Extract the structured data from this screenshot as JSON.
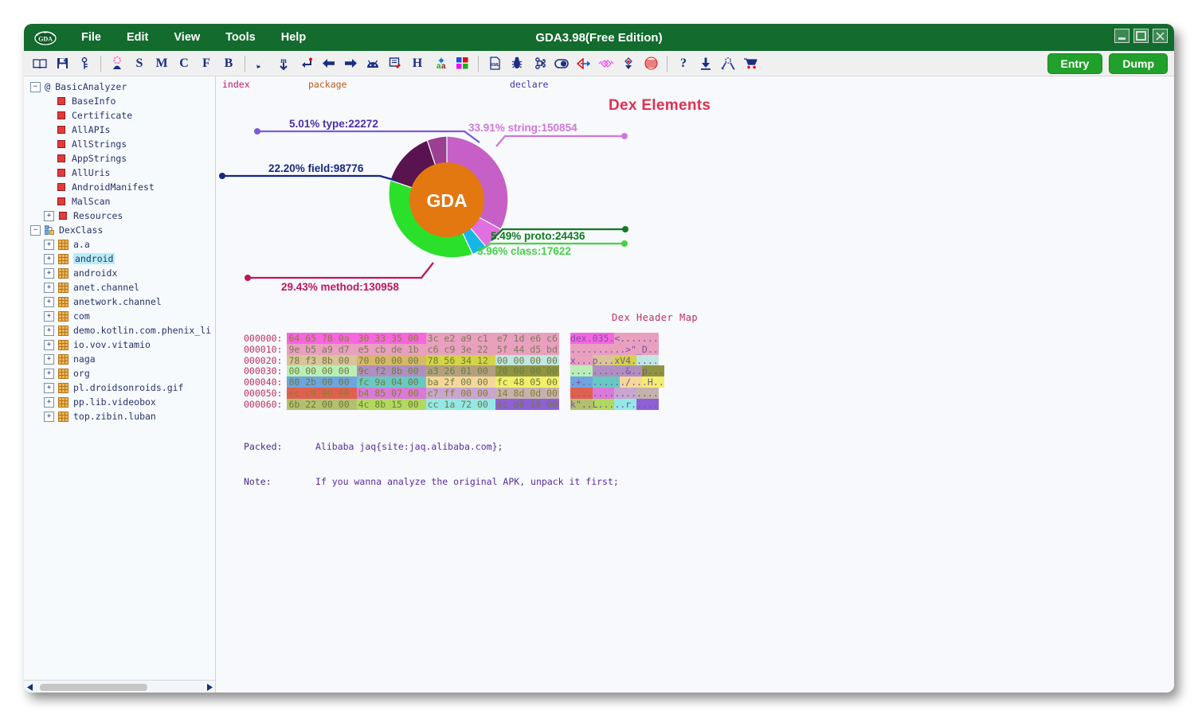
{
  "window": {
    "title": "GDA3.98(Free Edition)",
    "logo_text": "GDA",
    "controls": {
      "minimize": "minimize-icon",
      "maximize": "maximize-icon",
      "close": "close-icon"
    }
  },
  "menu": {
    "items": [
      {
        "label": "File",
        "name": "menu-file"
      },
      {
        "label": "Edit",
        "name": "menu-edit"
      },
      {
        "label": "View",
        "name": "menu-view"
      },
      {
        "label": "Tools",
        "name": "menu-tools"
      },
      {
        "label": "Help",
        "name": "menu-help"
      }
    ]
  },
  "toolbar": {
    "buttons": [
      {
        "icon": "book-icon",
        "text": ""
      },
      {
        "icon": "save-icon",
        "text": ""
      },
      {
        "icon": "key-icon",
        "text": ""
      },
      {
        "icon": "signature-icon",
        "text": ""
      },
      {
        "icon": "string-search-icon",
        "text": "S"
      },
      {
        "icon": "method-search-icon",
        "text": "M"
      },
      {
        "icon": "class-search-icon",
        "text": "C"
      },
      {
        "icon": "field-search-icon",
        "text": "F"
      },
      {
        "icon": "bytecode-search-icon",
        "text": "B"
      },
      {
        "icon": "cursor-icon",
        "text": ""
      },
      {
        "icon": "decompile-icon",
        "text": ""
      },
      {
        "icon": "enter-return-icon",
        "text": ""
      },
      {
        "icon": "back-arrow-icon",
        "text": ""
      },
      {
        "icon": "forward-arrow-icon",
        "text": ""
      },
      {
        "icon": "android-icon",
        "text": ""
      },
      {
        "icon": "note-icon",
        "text": ""
      },
      {
        "icon": "hex-icon",
        "text": "H"
      },
      {
        "icon": "translate-icon",
        "text": ""
      },
      {
        "icon": "color-grid-icon",
        "text": ""
      },
      {
        "icon": "xml-file-icon",
        "text": ""
      },
      {
        "icon": "bug-icon",
        "text": ""
      },
      {
        "icon": "command-icon",
        "text": ""
      },
      {
        "icon": "switch-icon",
        "text": ""
      },
      {
        "icon": "xref-icon",
        "text": ""
      },
      {
        "icon": "diff-icon",
        "text": ""
      },
      {
        "icon": "download-arrow-icon",
        "text": ""
      },
      {
        "icon": "fingerprint-icon",
        "text": ""
      },
      {
        "icon": "help-icon",
        "text": "?"
      },
      {
        "icon": "export-icon",
        "text": ""
      },
      {
        "icon": "network-icon",
        "text": ""
      },
      {
        "icon": "cart-icon",
        "text": ""
      }
    ],
    "entry_label": "Entry",
    "dump_label": "Dump"
  },
  "sidebar": {
    "groups": [
      {
        "label": "BasicAnalyzer",
        "icon": "at-icon",
        "expanded": true,
        "items": [
          {
            "label": "BaseInfo",
            "icon": "red-square-icon",
            "expandable": false
          },
          {
            "label": "Certificate",
            "icon": "red-square-icon",
            "expandable": false
          },
          {
            "label": "AllAPIs",
            "icon": "red-square-icon",
            "expandable": false
          },
          {
            "label": "AllStrings",
            "icon": "red-square-icon",
            "expandable": false
          },
          {
            "label": "AppStrings",
            "icon": "red-square-icon",
            "expandable": false
          },
          {
            "label": "AllUris",
            "icon": "red-square-icon",
            "expandable": false
          },
          {
            "label": "AndroidManifest",
            "icon": "red-square-icon",
            "expandable": false
          },
          {
            "label": "MalScan",
            "icon": "red-square-icon",
            "expandable": false
          },
          {
            "label": "Resources",
            "icon": "red-square-icon",
            "expandable": true
          }
        ]
      },
      {
        "label": "DexClass",
        "icon": "dexclass-icon",
        "expanded": true,
        "items": [
          {
            "label": "a.a",
            "icon": "package-icon",
            "expandable": true
          },
          {
            "label": "android",
            "icon": "package-icon",
            "expandable": true,
            "selected": true
          },
          {
            "label": "androidx",
            "icon": "package-icon",
            "expandable": true
          },
          {
            "label": "anet.channel",
            "icon": "package-icon",
            "expandable": true
          },
          {
            "label": "anetwork.channel",
            "icon": "package-icon",
            "expandable": true
          },
          {
            "label": "com",
            "icon": "package-icon",
            "expandable": true
          },
          {
            "label": "demo.kotlin.com.phenix_li",
            "icon": "package-icon",
            "expandable": true
          },
          {
            "label": "io.vov.vitamio",
            "icon": "package-icon",
            "expandable": true
          },
          {
            "label": "naga",
            "icon": "package-icon",
            "expandable": true
          },
          {
            "label": "org",
            "icon": "package-icon",
            "expandable": true
          },
          {
            "label": "pl.droidsonroids.gif",
            "icon": "package-icon",
            "expandable": true
          },
          {
            "label": "pp.lib.videobox",
            "icon": "package-icon",
            "expandable": true
          },
          {
            "label": "top.zibin.luban",
            "icon": "package-icon",
            "expandable": true
          }
        ]
      }
    ],
    "scrollbar": {
      "left_arrow": "scroll-left-icon",
      "right_arrow": "scroll-right-icon"
    }
  },
  "tabs": [
    {
      "label": "index",
      "name": "tab-index"
    },
    {
      "label": "package",
      "name": "tab-package"
    },
    {
      "label": "declare",
      "name": "tab-declare"
    }
  ],
  "chart_data": {
    "type": "pie",
    "title": "Dex Elements",
    "center_label": "GDA",
    "center_color": "#e2780f",
    "categories": [
      "string",
      "proto",
      "class",
      "method",
      "field",
      "type"
    ],
    "values": [
      150854,
      24436,
      17622,
      130958,
      98776,
      22272
    ],
    "percents": [
      33.91,
      5.49,
      3.96,
      29.43,
      22.2,
      5.01
    ],
    "colors": [
      "#c65fc6",
      "#e06fe0",
      "#17b6e8",
      "#2ae02a",
      "#59144f",
      "#9b3f93"
    ],
    "labels": [
      {
        "text": "33.91% string:150854",
        "color": "#cf78d8"
      },
      {
        "text": "5.49% proto:24436",
        "color": "#0f7a1e"
      },
      {
        "text": "3.96% class:17622",
        "color": "#42d442"
      },
      {
        "text": "29.43% method:130958",
        "color": "#c2135c"
      },
      {
        "text": "22.20% field:98776",
        "color": "#16287e"
      },
      {
        "text": "5.01% type:22272",
        "color": "#4b2fa8"
      }
    ],
    "legend": "callout-lines",
    "grid": false
  },
  "hexmap": {
    "title": "Dex Header Map",
    "rows": [
      {
        "offset": "000000:",
        "groups": [
          {
            "hex": "64 65 78 0a",
            "bg": "#f765e0",
            "fg": "#8a7d2e"
          },
          {
            "hex": "30 33 35 00",
            "bg": "#f765e0",
            "fg": "#8a7d2e"
          },
          {
            "hex": "3c e2 a9 c1",
            "bg": "#e8a0be",
            "fg": "#7f7a58"
          },
          {
            "hex": "e7 1d e6 c6",
            "bg": "#e8a0be",
            "fg": "#7f7a58"
          }
        ],
        "ascii": [
          {
            "text": "dex.035.",
            "bg": "#f765e0",
            "fg": "#7a4fa8"
          },
          {
            "text": "<.......",
            "bg": "#e8a0be",
            "fg": "#7a4fa8"
          }
        ]
      },
      {
        "offset": "000010:",
        "groups": [
          {
            "hex": "9e b5 a9 d7",
            "bg": "#e8a0be",
            "fg": "#7f7a58"
          },
          {
            "hex": "e5 cb de 1b",
            "bg": "#e8a0be",
            "fg": "#7f7a58"
          },
          {
            "hex": "c6 c9 3e 22",
            "bg": "#e8a0be",
            "fg": "#7f7a58"
          },
          {
            "hex": "5f 44 d5 bd",
            "bg": "#e8a0be",
            "fg": "#7f7a58"
          }
        ],
        "ascii": [
          {
            "text": "..........>\"_D..",
            "bg": "#e8a0be",
            "fg": "#7a4fa8"
          }
        ]
      },
      {
        "offset": "000020:",
        "groups": [
          {
            "hex": "78 f3 8b 00",
            "bg": "#d9c39a",
            "fg": "#6f7a3e"
          },
          {
            "hex": "70 00 00 00",
            "bg": "#d6b86a",
            "fg": "#6f7a3e"
          },
          {
            "hex": "78 56 34 12",
            "bg": "#d3d447",
            "fg": "#6f7a3e"
          },
          {
            "hex": "00 00 00 00",
            "bg": "#bfe6e0",
            "fg": "#6f7a3e"
          }
        ],
        "ascii": [
          {
            "text": "x...",
            "bg": "#e8a0be",
            "fg": "#7a4fa8"
          },
          {
            "text": "p...",
            "bg": "#d9c39a",
            "fg": "#7a4fa8"
          },
          {
            "text": "xV4.",
            "bg": "#d3d447",
            "fg": "#7a4fa8"
          },
          {
            "text": "....",
            "bg": "#bfe6e0",
            "fg": "#7a4fa8"
          }
        ]
      },
      {
        "offset": "000030:",
        "groups": [
          {
            "hex": "00 00 00 00",
            "bg": "#b8efb6",
            "fg": "#6f7a3e"
          },
          {
            "hex": "9c f2 8b 00",
            "bg": "#b08fc0",
            "fg": "#6f7a3e"
          },
          {
            "hex": "a3 26 01 00",
            "bg": "#b3a07f",
            "fg": "#6f7a3e"
          },
          {
            "hex": "70 00 00 00",
            "bg": "#8f9440",
            "fg": "#6f7a3e"
          }
        ],
        "ascii": [
          {
            "text": "....",
            "bg": "#b8efb6",
            "fg": "#7a4fa8"
          },
          {
            "text": "......&..",
            "bg": "#b08fc0",
            "fg": "#7a4fa8"
          },
          {
            "text": "p...",
            "bg": "#8f9440",
            "fg": "#7a4fa8"
          }
        ]
      },
      {
        "offset": "000040:",
        "groups": [
          {
            "hex": "80 2b 00 00",
            "bg": "#6ea5e0",
            "fg": "#6f7a3e"
          },
          {
            "hex": "fc 9a 04 00",
            "bg": "#68c9c3",
            "fg": "#6f7a3e"
          },
          {
            "hex": "ba 2f 00 00",
            "bg": "#f5d79b",
            "fg": "#6f7a3e"
          },
          {
            "hex": "fc 48 05 00",
            "bg": "#f2ef6e",
            "fg": "#6f7a3e"
          }
        ],
        "ascii": [
          {
            "text": ".+..",
            "bg": "#6ea5e0",
            "fg": "#7a4fa8"
          },
          {
            "text": ".....",
            "bg": "#68c9c3",
            "fg": "#7a4fa8"
          },
          {
            "text": "./..",
            "bg": "#f5d79b",
            "fg": "#7a4fa8"
          },
          {
            "text": ".H..",
            "bg": "#f2ef6e",
            "fg": "#7a4fa8"
          }
        ]
      },
      {
        "offset": "000050:",
        "groups": [
          {
            "hex": "ec c0 00 00",
            "bg": "#e06050",
            "fg": "#8a7d2e"
          },
          {
            "hex": "b4 85 07 00",
            "bg": "#d979d9",
            "fg": "#8a7d2e"
          },
          {
            "hex": "c7 ff 00 00",
            "bg": "#c8a6cf",
            "fg": "#8a7d2e"
          },
          {
            "hex": "14 8d 0d 00",
            "bg": "#c4b2ad",
            "fg": "#8a7d2e"
          }
        ],
        "ascii": [
          {
            "text": "....",
            "bg": "#e06050",
            "fg": "#7a4fa8"
          },
          {
            "text": "....",
            "bg": "#d979d9",
            "fg": "#7a4fa8"
          },
          {
            "text": "....",
            "bg": "#c8a6cf",
            "fg": "#7a4fa8"
          },
          {
            "text": "....",
            "bg": "#c4b2ad",
            "fg": "#7a4fa8"
          }
        ]
      },
      {
        "offset": "000060:",
        "groups": [
          {
            "hex": "6b 22 00 00",
            "bg": "#b3bf6f",
            "fg": "#6f7a3e"
          },
          {
            "hex": "4c 8b 15 00",
            "bg": "#b2d95e",
            "fg": "#6f7a3e"
          },
          {
            "hex": "cc 1a 72 00",
            "bg": "#93e8e6",
            "fg": "#6f7a3e"
          },
          {
            "hex": "ac d8 19 00",
            "bg": "#8f5fd6",
            "fg": "#6f7a3e"
          }
        ],
        "ascii": [
          {
            "text": "k\"..",
            "bg": "#b3bf6f",
            "fg": "#7a4fa8"
          },
          {
            "text": "L...",
            "bg": "#b2d95e",
            "fg": "#7a4fa8"
          },
          {
            "text": "..r.",
            "bg": "#93e8e6",
            "fg": "#7a4fa8"
          },
          {
            "text": "....",
            "bg": "#8f5fd6",
            "fg": "#7a4fa8"
          }
        ]
      }
    ]
  },
  "footer": {
    "packed_label": "Packed:",
    "packed_value": "Alibaba jaq{site:jaq.alibaba.com};",
    "note_label": "Note:",
    "note_value": "If you wanna analyze the original APK, unpack it first;"
  }
}
